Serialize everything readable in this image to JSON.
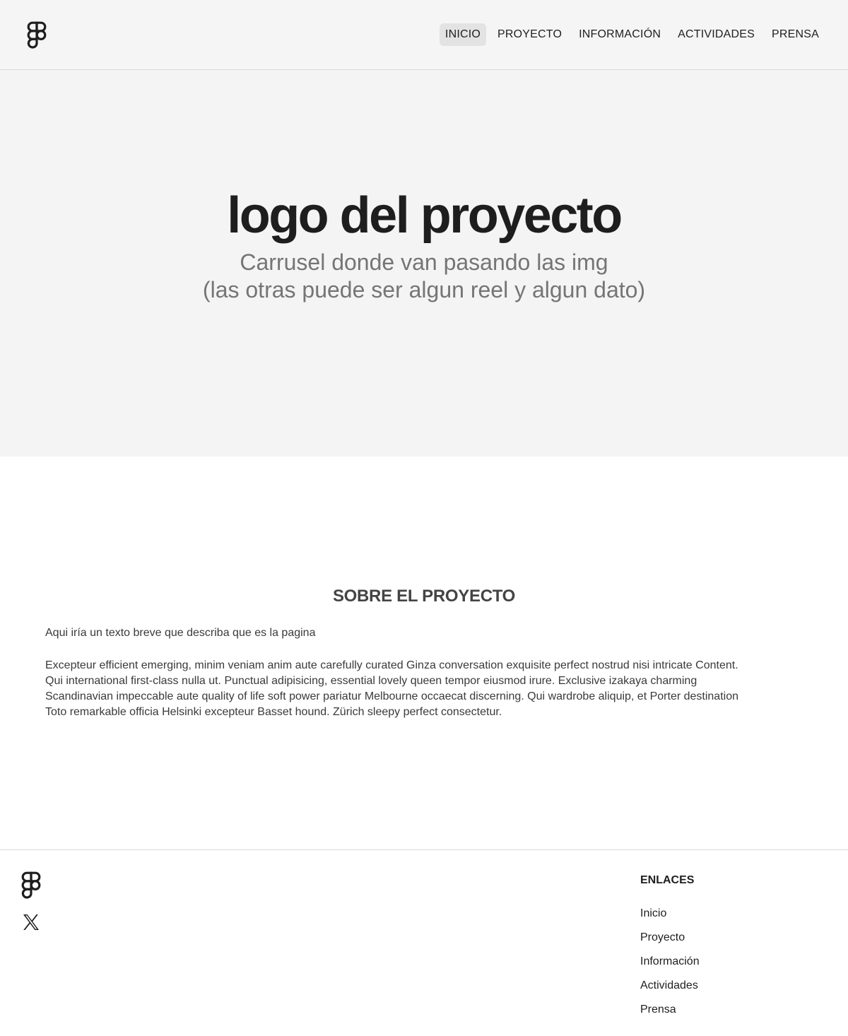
{
  "header": {
    "logo_icon": "figma-logo-icon",
    "nav": [
      {
        "label": "INICIO",
        "active": true
      },
      {
        "label": "PROYECTO",
        "active": false
      },
      {
        "label": "INFORMACIÓN",
        "active": false
      },
      {
        "label": "ACTIVIDADES",
        "active": false
      },
      {
        "label": "PRENSA",
        "active": false
      }
    ]
  },
  "hero": {
    "title": "logo del proyecto",
    "subtitle_line1": "Carrusel donde van pasando las img",
    "subtitle_line2": "(las otras puede ser algun reel y algun dato)"
  },
  "about": {
    "title": "SOBRE EL PROYECTO",
    "intro": "Aqui iría un texto breve que describa que es la pagina",
    "body": "Excepteur efficient emerging, minim veniam anim aute carefully curated Ginza conversation exquisite perfect nostrud nisi intricate Content.\nQui  international first-class nulla ut. Punctual adipisicing, essential lovely queen tempor eiusmod irure. Exclusive izakaya charming\nScandinavian impeccable aute quality of life soft power pariatur Melbourne occaecat discerning. Qui wardrobe aliquip, et Porter destination\nToto remarkable officia Helsinki excepteur Basset hound. Zürich sleepy perfect consectetur."
  },
  "footer": {
    "logo_icon": "figma-logo-icon",
    "social_icon": "x-icon",
    "links_title": "ENLACES",
    "links": [
      "Inicio",
      "Proyecto",
      "Información",
      "Actividades",
      "Prensa"
    ]
  },
  "colors": {
    "header_bg": "#f5f5f5",
    "hero_bg": "#f4f4f4",
    "text_dark": "#1e1e1e",
    "text_muted": "#757575",
    "nav_active_bg": "#e3e3e3"
  }
}
